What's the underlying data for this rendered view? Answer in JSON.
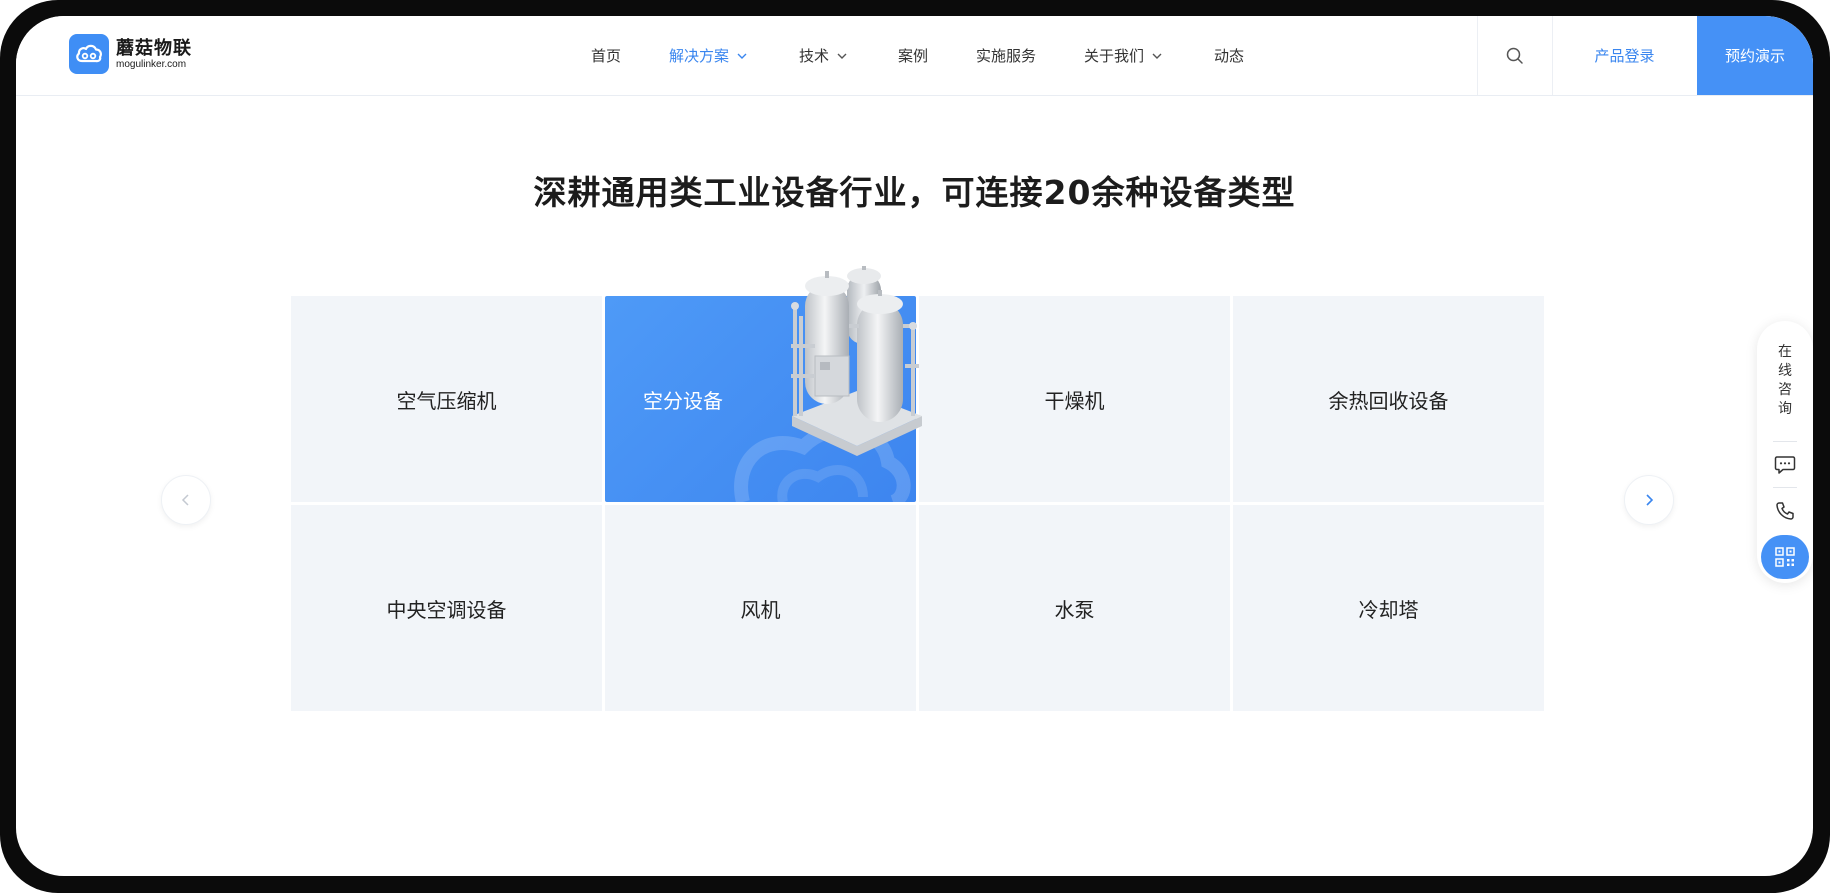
{
  "brand": {
    "name_cn": "蘑菇物联",
    "name_en": "mogulinker.com"
  },
  "nav": {
    "items": [
      {
        "label": "首页",
        "active": false,
        "dropdown": false
      },
      {
        "label": "解决方案",
        "active": true,
        "dropdown": true
      },
      {
        "label": "技术",
        "active": false,
        "dropdown": true
      },
      {
        "label": "案例",
        "active": false,
        "dropdown": false
      },
      {
        "label": "实施服务",
        "active": false,
        "dropdown": false
      },
      {
        "label": "关于我们",
        "active": false,
        "dropdown": true
      },
      {
        "label": "动态",
        "active": false,
        "dropdown": false
      }
    ],
    "search_icon": "search-icon",
    "login_label": "产品登录",
    "demo_label": "预约演示"
  },
  "section": {
    "title": "深耕通用类工业设备行业，可连接20余种设备类型"
  },
  "devices": [
    {
      "label": "空气压缩机",
      "active": false
    },
    {
      "label": "空分设备",
      "active": true
    },
    {
      "label": "干燥机",
      "active": false
    },
    {
      "label": "余热回收设备",
      "active": false
    },
    {
      "label": "中央空调设备",
      "active": false
    },
    {
      "label": "风机",
      "active": false
    },
    {
      "label": "水泵",
      "active": false
    },
    {
      "label": "冷却塔",
      "active": false
    }
  ],
  "float_panel": {
    "consult_chars": [
      "在",
      "线",
      "咨",
      "询"
    ],
    "icons": [
      "chat-icon",
      "phone-icon",
      "qrcode-icon"
    ]
  },
  "colors": {
    "accent": "#4591f6",
    "tile_bg": "#f2f5f9",
    "active_text": "#3a86ef"
  }
}
